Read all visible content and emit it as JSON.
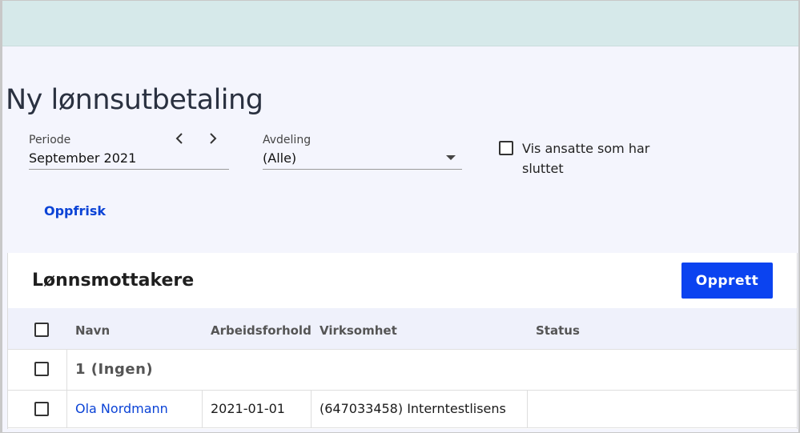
{
  "page": {
    "title": "Ny lønnsutbetaling"
  },
  "filters": {
    "period": {
      "label": "Periode",
      "value": "September 2021",
      "prev_glyph": "‹",
      "next_glyph": "›"
    },
    "department": {
      "label": "Avdeling",
      "value": "(Alle)"
    },
    "show_quit": {
      "label": "Vis ansatte som har sluttet",
      "checked": false
    },
    "refresh_label": "Oppfrisk"
  },
  "recipients": {
    "title": "Lønnsmottakere",
    "create_label": "Opprett",
    "columns": [
      "Navn",
      "Arbeidsforhold",
      "Virksomhet",
      "Status"
    ],
    "groups": [
      {
        "label": "1 (Ingen)",
        "rows": [
          {
            "name": "Ola Nordmann",
            "employment": "2021-01-01",
            "company": "(647033458) Interntestlisens",
            "status": ""
          }
        ]
      }
    ]
  },
  "colors": {
    "topbar": "#d6e9ea",
    "background": "#f4f5fd",
    "accent": "#0b43f0",
    "link": "#0b43d6"
  }
}
